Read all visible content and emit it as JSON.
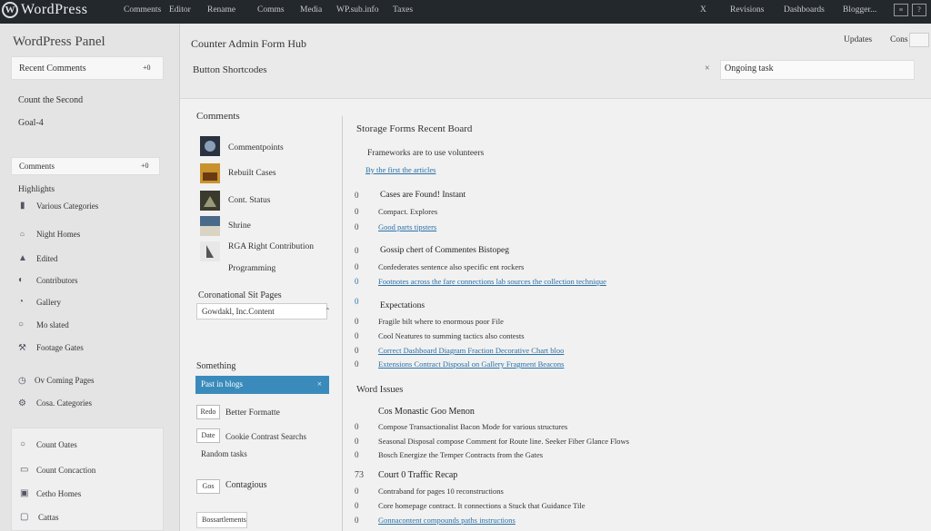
{
  "topbar": {
    "logo_text": "WordPress",
    "nav": [
      "Comments",
      "Editor",
      "Rename",
      "Comms",
      "Media",
      "WP.sub.info",
      "Taxes"
    ],
    "right": [
      "Revisions",
      "Dashboards",
      "Blogger..."
    ],
    "icon_box": "X"
  },
  "sidebar": {
    "title": "WordPress Panel",
    "section_label": "Recent Comments",
    "section_badge": "+0",
    "item_a": "Count the Second",
    "item_b": "Goal-4",
    "panel2_label": "Comments",
    "panel2_badge": "+0",
    "highlights": "Highlights",
    "items": [
      {
        "icon": "page-icon",
        "label": "Various Categories"
      },
      {
        "icon": "tag-icon",
        "label": "Night Homes"
      },
      {
        "icon": "user-icon",
        "label": "Edited"
      },
      {
        "icon": "comment-icon",
        "label": "Contributors"
      },
      {
        "icon": "chat-icon",
        "label": "Gallery"
      },
      {
        "icon": "circle-icon",
        "label": "Mo slated"
      },
      {
        "icon": "tool-icon",
        "label": "Footage Gates"
      },
      {
        "icon": "clock-icon",
        "label": "Ov Coming Pages"
      },
      {
        "icon": "gear-icon",
        "label": "Cosa. Categories"
      },
      {
        "icon": "ring-icon",
        "label": "Count Oates"
      },
      {
        "icon": "calendar-icon",
        "label": "Count Concaction"
      },
      {
        "icon": "image-icon",
        "label": "Cetho Homes"
      },
      {
        "icon": "square-icon",
        "label": "Cattas"
      }
    ]
  },
  "header": {
    "page_title": "Counter Admin Form Hub",
    "subtitle": "Button Shortcodes",
    "btn1": "Updates",
    "btn2": "Cons",
    "search_value": "Ongoing task",
    "search_close": "×"
  },
  "left": {
    "heading": "Comments",
    "thumbs": [
      {
        "label": "Commentpoints"
      },
      {
        "label": "Rebuilt Cases"
      },
      {
        "label": "Cont. Status"
      },
      {
        "label": "Shrine"
      },
      {
        "label": "RGA Right Contribution"
      }
    ],
    "extra_item": "Programming",
    "select_heading": "Coronational Sit Pages",
    "select_value": "Gowdakl, Inc.Content",
    "select_caret": "⌃",
    "sub_heading": "Something",
    "blue_btn": "Past       in blogs",
    "blue_btn_arrow": "×",
    "rows": [
      {
        "btn": "Redo",
        "label": "Better Formatte"
      },
      {
        "btn": "Date",
        "label": "Cookie Contrast Searchs"
      }
    ],
    "single": "Random tasks",
    "last": {
      "btn": "Gos",
      "label": "Contagious"
    },
    "bottom": "Bossartlements"
  },
  "right": {
    "heading": "Storage Forms Recent Board",
    "desc": "Frameworks are to use volunteers",
    "desc_link": "By the first the articles",
    "groups": [
      {
        "num": "0",
        "title": "Cases are Found! Instant",
        "lines": [
          {
            "n": "0",
            "text": "Compact. Explores",
            "link": false
          },
          {
            "n": "0",
            "text": "Good parts tipsters",
            "link": true
          }
        ]
      },
      {
        "num": "0",
        "title": "Gossip chert of Commentes Bistopeg",
        "lines": [
          {
            "n": "0",
            "text": "Confederates sentence also specific ent rockers",
            "link": false
          },
          {
            "n": "0",
            "text": "Footnotes across the fare connections lab sources the collection technique",
            "link": true
          }
        ]
      },
      {
        "num": "0",
        "title": "Expectations",
        "lines": [
          {
            "n": "0",
            "text": "Fragile bilt where to enormous poor File",
            "link": false
          },
          {
            "n": "0",
            "text": "Cool Neatures to summing tactics also contests",
            "link": false
          },
          {
            "n": "0",
            "text": "Correct Dashboard Diagram Fraction Decorative Chart bloo",
            "link": true
          },
          {
            "n": "0",
            "text": "Extensions Contract Disposal on Gallery Fragment Beacons",
            "link": true
          }
        ]
      }
    ],
    "heading2": "Word Issues",
    "groups2": [
      {
        "title": "Cos Monastic Goo Menon",
        "lines": [
          {
            "n": "0",
            "text": "Compose Transactionalist Bacon Mode for various structures",
            "link": false
          },
          {
            "n": "0",
            "text": "Seasonal Disposal compose Comment for Route line. Seeker Fiber Glance Flows",
            "link": false
          },
          {
            "n": "0",
            "text": "Bosch Energize the Temper Contracts from the Gates",
            "link": false
          }
        ]
      },
      {
        "title": "Court 0 Traffic Recap",
        "num": "73",
        "lines": [
          {
            "n": "0",
            "text": "Contraband for pages 10 reconstructions",
            "link": false
          },
          {
            "n": "0",
            "text": "Core homepage contract. It connections a Stuck that Guidance Tile",
            "link": false
          },
          {
            "n": "0",
            "text": "Gonnacontent compounds paths instructions",
            "link": true
          }
        ]
      }
    ]
  }
}
